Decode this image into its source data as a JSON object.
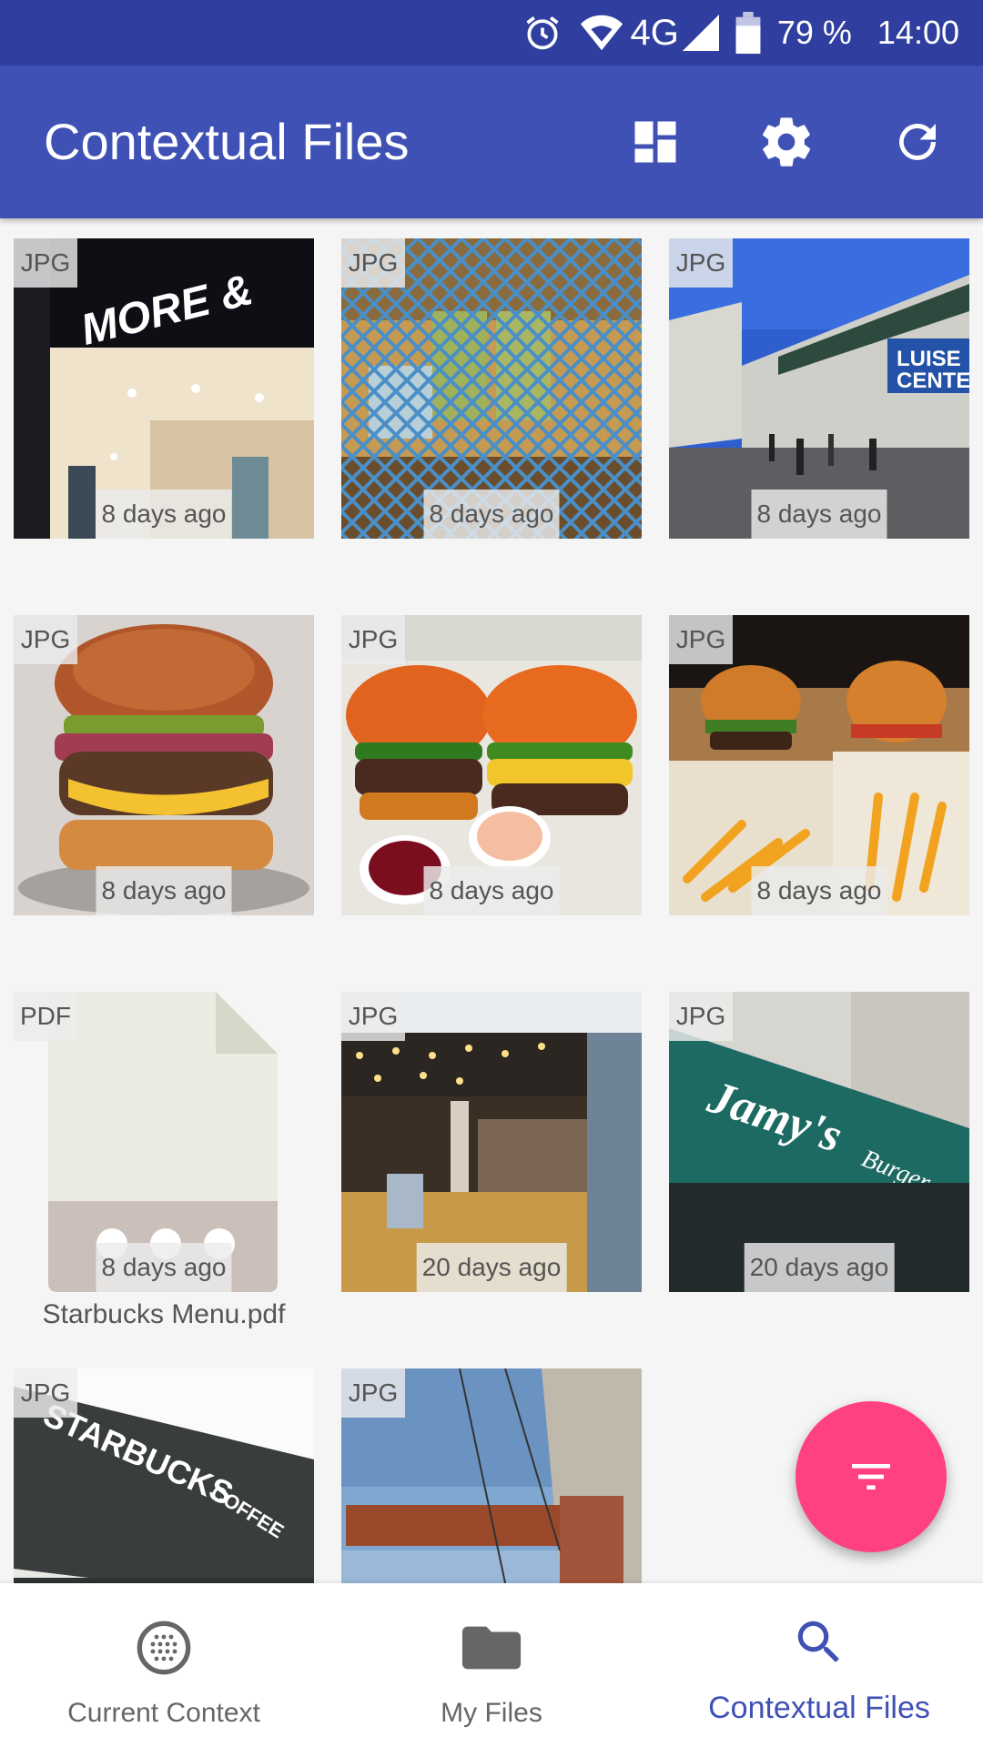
{
  "status_bar": {
    "network": "4G",
    "battery": "79 %",
    "time": "14:00",
    "icons": [
      "alarm-icon",
      "wifi-icon",
      "signal-icon",
      "battery-icon"
    ]
  },
  "app_bar": {
    "title": "Contextual Files",
    "actions": [
      "dashboard-icon",
      "settings-icon",
      "refresh-icon"
    ]
  },
  "files": [
    {
      "type": "JPG",
      "age": "8 days ago",
      "thumb": "store-entrance"
    },
    {
      "type": "JPG",
      "age": "8 days ago",
      "thumb": "drinks-behind-fence"
    },
    {
      "type": "JPG",
      "age": "8 days ago",
      "thumb": "shopping-plaza"
    },
    {
      "type": "JPG",
      "age": "8 days ago",
      "thumb": "burger"
    },
    {
      "type": "JPG",
      "age": "8 days ago",
      "thumb": "two-burgers"
    },
    {
      "type": "JPG",
      "age": "8 days ago",
      "thumb": "burgers-fries"
    },
    {
      "type": "PDF",
      "age": "8 days ago",
      "name": "Starbucks Menu.pdf",
      "thumb": "pdf-document"
    },
    {
      "type": "JPG",
      "age": "20 days ago",
      "thumb": "restaurant-interior"
    },
    {
      "type": "JPG",
      "age": "20 days ago",
      "thumb": "jamys-burger-sign"
    },
    {
      "type": "JPG",
      "thumb": "starbucks-sign"
    },
    {
      "type": "JPG",
      "thumb": "brick-chimney"
    }
  ],
  "fab": {
    "icon": "filter-icon"
  },
  "bottom_nav": [
    {
      "label": "Current Context",
      "icon": "context-icon",
      "active": false
    },
    {
      "label": "My Files",
      "icon": "folder-icon",
      "active": false
    },
    {
      "label": "Contextual Files",
      "icon": "search-icon",
      "active": true
    }
  ],
  "colors": {
    "primary": "#3f51b5",
    "primary_dark": "#303f9f",
    "accent": "#ff4081",
    "background": "#f5f5f5"
  }
}
